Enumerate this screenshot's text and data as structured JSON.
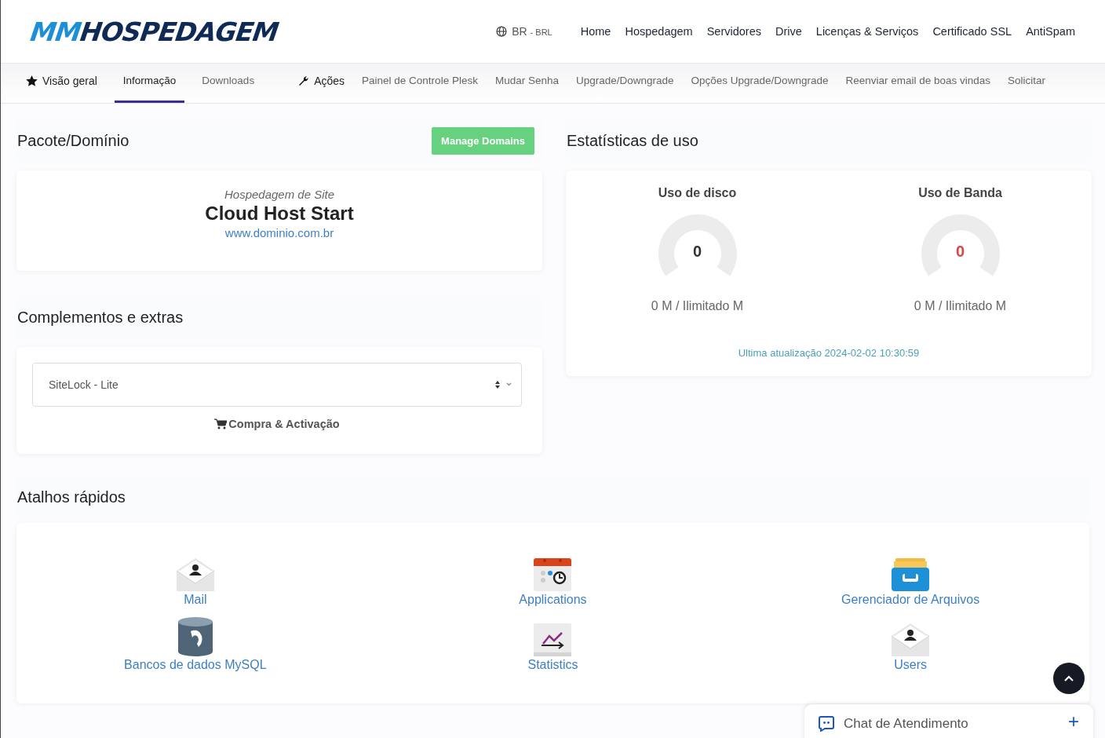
{
  "logo": {
    "accent": "MM",
    "main": "HOSPEDAGEM"
  },
  "locale": {
    "region": "BR",
    "separator": "-",
    "currency": "BRL"
  },
  "main_nav": [
    "Home",
    "Hospedagem",
    "Servidores",
    "Drive",
    "Licenças & Serviços",
    "Certificado SSL",
    "AntiSpam"
  ],
  "sub_nav": [
    {
      "label": "Visão geral",
      "kind": "star",
      "selected": false
    },
    {
      "label": "Informação",
      "kind": "link",
      "selected": true
    },
    {
      "label": "Downloads",
      "kind": "link",
      "selected": false
    },
    {
      "label": "Ações",
      "kind": "wrench",
      "selected": false
    },
    {
      "label": "Painel de Controle Plesk",
      "kind": "link",
      "selected": false
    },
    {
      "label": "Mudar Senha",
      "kind": "link",
      "selected": false
    },
    {
      "label": "Upgrade/Downgrade",
      "kind": "link",
      "selected": false
    },
    {
      "label": "Opções Upgrade/Downgrade",
      "kind": "link",
      "selected": false
    },
    {
      "label": "Reenviar email de boas vindas",
      "kind": "link",
      "selected": false
    },
    {
      "label": "Solicitar",
      "kind": "link",
      "selected": false
    }
  ],
  "package": {
    "title": "Pacote/Domínio",
    "button": "Manage Domains",
    "group": "Hospedagem de Site",
    "product": "Cloud Host Start",
    "domain": "www.dominio.com.br"
  },
  "addons": {
    "title": "Complementos e extras",
    "select_value": "SiteLock - Lite",
    "action": "Compra & Activação"
  },
  "usage": {
    "title": "Estatísticas de uso",
    "gauges": [
      {
        "title": "Uso de disco",
        "value": "0",
        "color": "#333333",
        "reading": "0 M / Ilimitado M"
      },
      {
        "title": "Uso de Banda",
        "value": "0",
        "color": "#dd4444",
        "reading": "0 M / Ilimitado M"
      }
    ],
    "updated": "Ultima atualização 2024-02-02 10:30:59"
  },
  "shortcuts": {
    "title": "Atalhos rápidos",
    "items": [
      {
        "label": "Mail",
        "kind": "mail"
      },
      {
        "label": "Applications",
        "kind": "apps"
      },
      {
        "label": "Gerenciador de Arquivos",
        "kind": "files"
      },
      {
        "label": "Bancos de dados MySQL",
        "kind": "database"
      },
      {
        "label": "Statistics",
        "kind": "stats"
      },
      {
        "label": "Users",
        "kind": "users"
      }
    ]
  },
  "chat": {
    "label": "Chat de Atendimento",
    "button": "+"
  }
}
